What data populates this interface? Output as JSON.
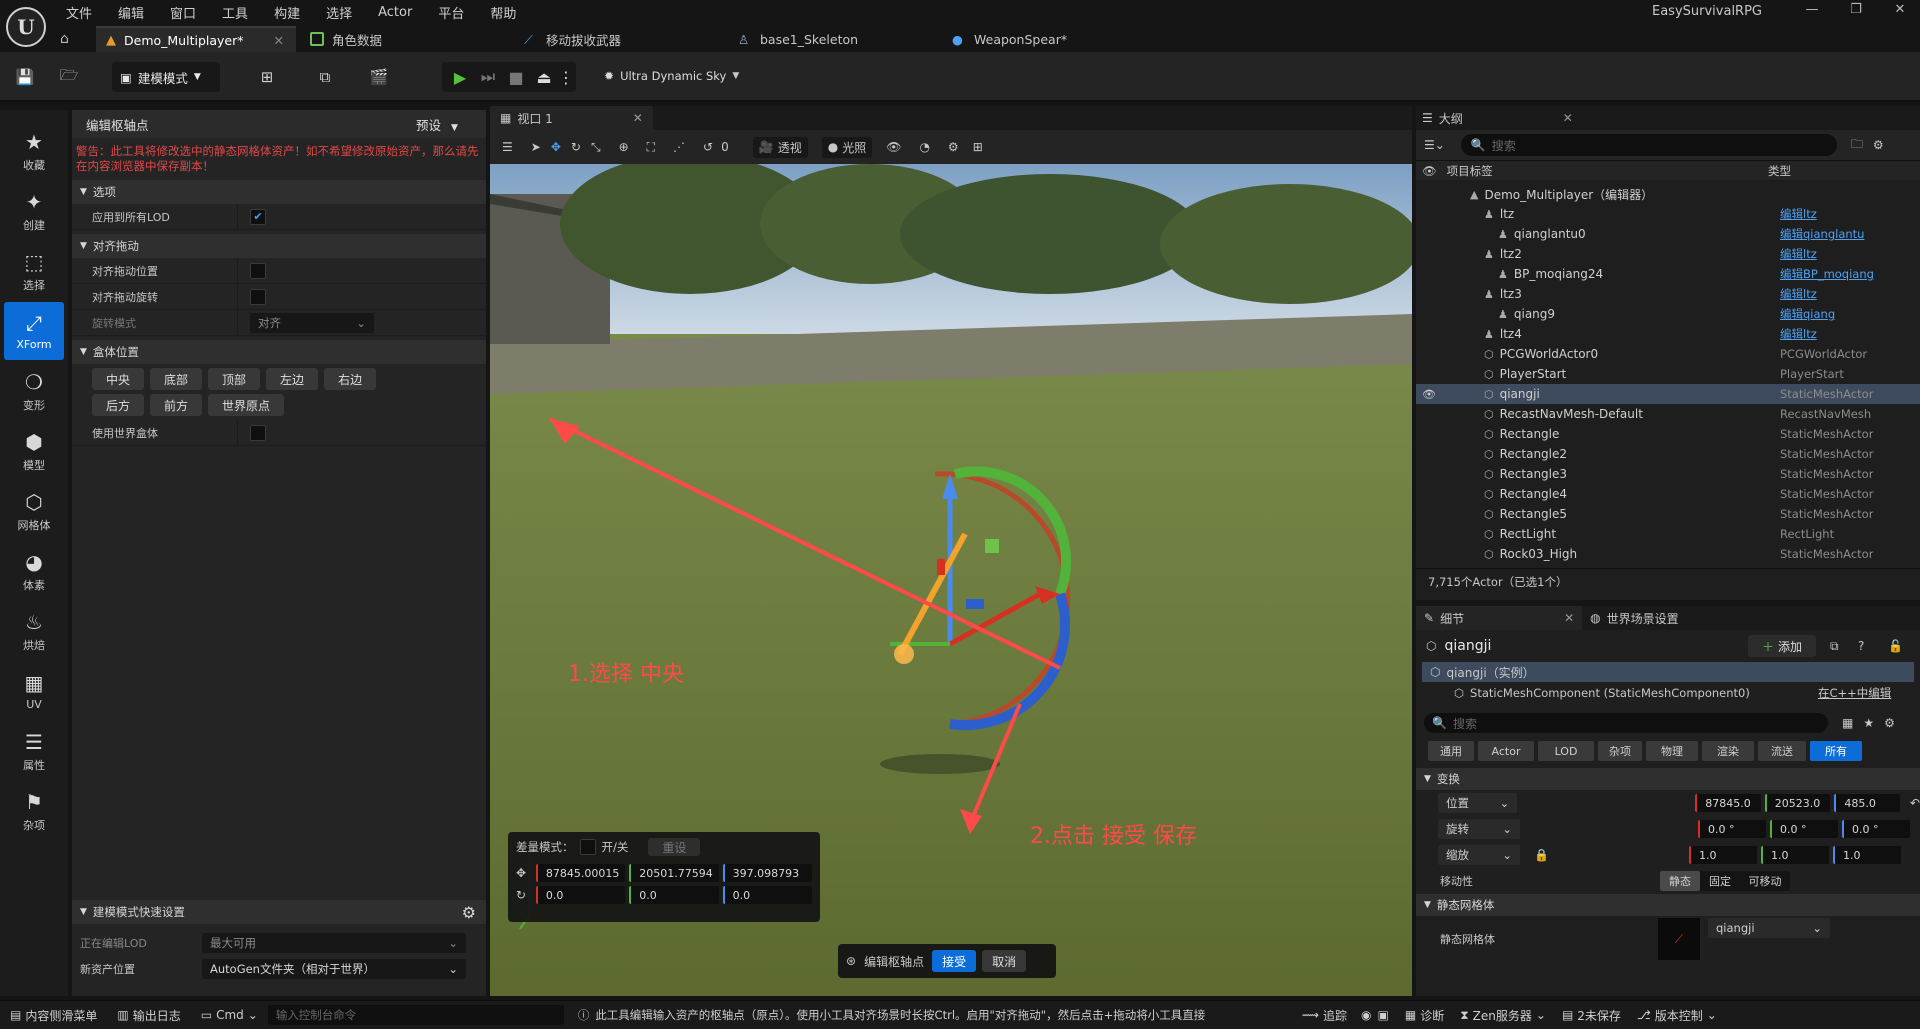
{
  "app": {
    "logo": "U",
    "title": "EasySurvivalRPG",
    "menu": [
      "文件",
      "编辑",
      "窗口",
      "工具",
      "构建",
      "选择",
      "Actor",
      "平台",
      "帮助"
    ],
    "tabs": [
      "Demo_Multiplayer*",
      "角色数据",
      "移动拔收武器",
      "base1_Skeleton",
      "WeaponSpear*"
    ]
  },
  "toolbar": {
    "mode_label": "建模模式",
    "sky_label": "Ultra Dynamic Sky"
  },
  "leftbar": {
    "items": [
      "收藏",
      "创建",
      "选择",
      "XForm",
      "变形",
      "模型",
      "网格体",
      "体素",
      "烘焙",
      "UV",
      "属性",
      "杂项"
    ]
  },
  "modpanel": {
    "title": "编辑枢轴点",
    "preset": "预设",
    "warning": "警告：此工具将修改选中的静态网格体资产！如不希望修改原始资产，那么请先在内容浏览器中保存副本！",
    "sections": {
      "options": "选项",
      "align": "对齐拖动",
      "box": "盒体位置"
    },
    "rows": {
      "apply_lod": "应用到所有LOD",
      "align_pos": "对齐拖动位置",
      "align_rot": "对齐拖动旋转",
      "rot_mode": "旋转模式",
      "rot_mode_value": "对齐",
      "use_world_box": "使用世界盒体"
    },
    "box_buttons_row1": [
      "中央",
      "底部",
      "顶部",
      "左边",
      "右边"
    ],
    "box_buttons_row2": [
      "后方",
      "前方",
      "世界原点"
    ],
    "quick": {
      "title": "建模模式快速设置",
      "edit_lod_label": "正在编辑LOD",
      "edit_lod_value": "最大可用",
      "new_asset_label": "新资产位置",
      "new_asset_value": "AutoGen文件夹（相对于世界）"
    }
  },
  "viewport": {
    "tab": "视口 1",
    "perspective": "透视",
    "lighting": "光照",
    "snap_value": "0",
    "annotation1": "1.选择 中央",
    "annotation2": "2.点击 接受 保存",
    "delta_label": "差量模式：",
    "toggle_label": "开/关",
    "reset_label": "重设",
    "pos": [
      "87845.00015",
      "20501.77594",
      "397.098793"
    ],
    "rot": [
      "0.0",
      "0.0",
      "0.0"
    ],
    "accept_bar_label": "编辑枢轴点",
    "accept": "接受",
    "cancel": "取消"
  },
  "outliner": {
    "title": "大纲",
    "search_placeholder": "搜索",
    "col_label": "项目标签",
    "col_type": "类型",
    "rows": [
      {
        "indent": 1,
        "name": "Demo_Multiplayer（编辑器）",
        "type": "",
        "link": false
      },
      {
        "indent": 2,
        "name": "ltz",
        "type": "编辑ltz",
        "link": true
      },
      {
        "indent": 3,
        "name": "qianglantu0",
        "type": "编辑qianglantu",
        "link": true
      },
      {
        "indent": 2,
        "name": "ltz2",
        "type": "编辑ltz",
        "link": true
      },
      {
        "indent": 3,
        "name": "BP_moqiang24",
        "type": "编辑BP_moqiang",
        "link": true
      },
      {
        "indent": 2,
        "name": "ltz3",
        "type": "编辑ltz",
        "link": true
      },
      {
        "indent": 3,
        "name": "qiang9",
        "type": "编辑qiang",
        "link": true
      },
      {
        "indent": 2,
        "name": "ltz4",
        "type": "编辑ltz",
        "link": true
      },
      {
        "indent": 2,
        "name": "PCGWorldActor0",
        "type": "PCGWorldActor",
        "link": false
      },
      {
        "indent": 2,
        "name": "PlayerStart",
        "type": "PlayerStart",
        "link": false
      },
      {
        "indent": 2,
        "name": "qiangji",
        "type": "StaticMeshActor",
        "link": false,
        "selected": true
      },
      {
        "indent": 2,
        "name": "RecastNavMesh-Default",
        "type": "RecastNavMesh",
        "link": false
      },
      {
        "indent": 2,
        "name": "Rectangle",
        "type": "StaticMeshActor",
        "link": false
      },
      {
        "indent": 2,
        "name": "Rectangle2",
        "type": "StaticMeshActor",
        "link": false
      },
      {
        "indent": 2,
        "name": "Rectangle3",
        "type": "StaticMeshActor",
        "link": false
      },
      {
        "indent": 2,
        "name": "Rectangle4",
        "type": "StaticMeshActor",
        "link": false
      },
      {
        "indent": 2,
        "name": "Rectangle5",
        "type": "StaticMeshActor",
        "link": false
      },
      {
        "indent": 2,
        "name": "RectLight",
        "type": "RectLight",
        "link": false
      },
      {
        "indent": 2,
        "name": "Rock03_High",
        "type": "StaticMeshActor",
        "link": false
      }
    ],
    "count": "7,715个Actor（已选1个）"
  },
  "details": {
    "tab1": "细节",
    "tab2": "世界场景设置",
    "object": "qiangji",
    "add": "添加",
    "instance": "qiangji（实例）",
    "component": "StaticMeshComponent (StaticMeshComponent0)",
    "component_link": "在C++中编辑",
    "search_placeholder": "搜索",
    "filters": [
      "通用",
      "Actor",
      "LOD",
      "杂项",
      "物理",
      "渲染",
      "流送",
      "所有"
    ],
    "transform": "变换",
    "location": "位置",
    "rotation": "旋转",
    "scale": "缩放",
    "loc_vals": [
      "87845.0",
      "20523.0",
      "485.0"
    ],
    "rot_vals": [
      "0.0 °",
      "0.0 °",
      "0.0 °"
    ],
    "scale_vals": [
      "1.0",
      "1.0",
      "1.0"
    ],
    "mobility": "移动性",
    "mobility_opts": [
      "静态",
      "固定",
      "可移动"
    ],
    "static_mesh_section": "静态网格体",
    "static_mesh_label": "静态网格体",
    "static_mesh_value": "qiangji"
  },
  "statusbar": {
    "content_drawer": "内容侧滑菜单",
    "output_log": "输出日志",
    "cmd": "Cmd",
    "cmd_placeholder": "输入控制台命令",
    "hint": "此工具编辑输入资产的枢轴点（原点）。使用小工具对齐场景时长按Ctrl。启用\"对齐拖动\"，然后点击+拖动将小工具直接",
    "trace": "追踪",
    "diag": "诊断",
    "zen": "Zen服务器",
    "unsaved": "2未保存",
    "source": "版本控制"
  },
  "colors": {
    "accent": "#0d6dd8",
    "warning": "#e04848",
    "annotation": "#ff4a4a",
    "link": "#4ea2f5"
  }
}
